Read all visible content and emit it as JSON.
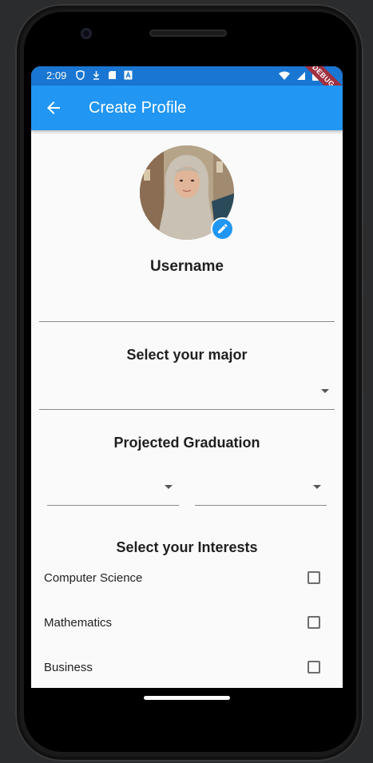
{
  "status_bar": {
    "time": "2:09",
    "debug_label": "DEBUG"
  },
  "app_bar": {
    "title": "Create Profile"
  },
  "profile": {
    "username": "Username"
  },
  "major": {
    "title": "Select your major"
  },
  "graduation": {
    "title": "Projected Graduation"
  },
  "interests": {
    "title": "Select your Interests",
    "items": [
      {
        "label": "Computer Science",
        "checked": false
      },
      {
        "label": "Mathematics",
        "checked": false
      },
      {
        "label": "Business",
        "checked": false
      }
    ]
  },
  "colors": {
    "status_bar": "#1976d2",
    "app_bar": "#2196f3",
    "background": "#fafafa",
    "debug_ribbon": "#a03040"
  }
}
